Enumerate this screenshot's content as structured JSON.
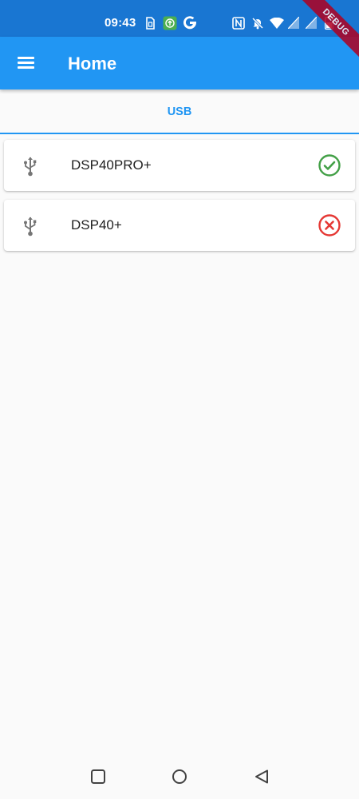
{
  "status_bar": {
    "time": "09:43",
    "icons": [
      "sim-icon",
      "upload-app-icon",
      "google-icon",
      "nfc-icon",
      "mute-icon",
      "wifi-icon",
      "signal-icon",
      "signal-icon",
      "battery-icon"
    ]
  },
  "debug_banner": "DEBUG",
  "app_bar": {
    "menu_icon": "menu-icon",
    "title": "Home"
  },
  "tabs": [
    {
      "label": "USB",
      "selected": true
    }
  ],
  "devices": [
    {
      "name": "DSP40PRO+",
      "icon": "usb-icon",
      "status": "connected",
      "status_icon": "check-circle-icon"
    },
    {
      "name": "DSP40+",
      "icon": "usb-icon",
      "status": "disconnected",
      "status_icon": "cancel-circle-icon"
    }
  ],
  "colors": {
    "status_bar": "#1976d2",
    "app_bar": "#2196f3",
    "accent": "#2196f3",
    "connected": "#43a047",
    "disconnected": "#e53935",
    "icon_grey": "#757575"
  },
  "nav_bar": {
    "buttons": [
      "recents-icon",
      "home-icon",
      "back-icon"
    ]
  }
}
